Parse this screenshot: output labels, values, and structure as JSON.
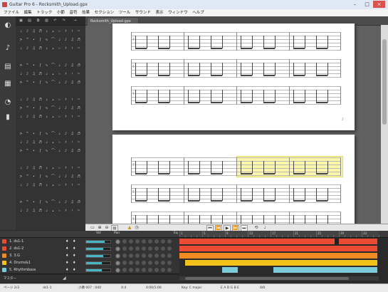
{
  "window": {
    "title": "Guitar Pro 6 - Rocksmith_Upload.gpx",
    "minimize": "–",
    "maximize": "□",
    "close": "×"
  },
  "menu": [
    "ファイル",
    "編集",
    "トラック",
    "小節",
    "音符",
    "効果",
    "セクション",
    "ツール",
    "サウンド",
    "表示",
    "ウィンドウ",
    "ヘルプ"
  ],
  "document": {
    "tab_label": "Rocksmith_Upload.gpx",
    "page_number": "2"
  },
  "mixer": {
    "header_vol": "Vol",
    "header_pan": "Pan",
    "header_eq": "Eq",
    "tracks": [
      {
        "name": "1. ds1-1",
        "color": "#e94b35",
        "vol": 0.75,
        "pan": 0.5
      },
      {
        "name": "2. ds1-2",
        "color": "#e94b35",
        "vol": 0.7,
        "pan": 0.5
      },
      {
        "name": "3. 3.G",
        "color": "#f08a22",
        "vol": 0.7,
        "pan": 0.5
      },
      {
        "name": "4. Drums&1",
        "color": "#f2c21b",
        "vol": 0.65,
        "pan": 0.5
      },
      {
        "name": "5. Rhythmbass",
        "color": "#7ccbd8",
        "vol": 0.65,
        "pan": 0.5
      }
    ],
    "master": "マスター",
    "ruler_numbers": [
      "1",
      "5",
      "9",
      "13",
      "17",
      "21",
      "25",
      "29",
      "33"
    ]
  },
  "status": {
    "page": "ページ 2/3",
    "track": "ds1-1",
    "bar": "小節 007 : 040",
    "time_sig": "4:4",
    "tempo": "0:00/1:00",
    "key": "Key: C major",
    "tuning": "E A D G B E",
    "position": "0/0"
  }
}
